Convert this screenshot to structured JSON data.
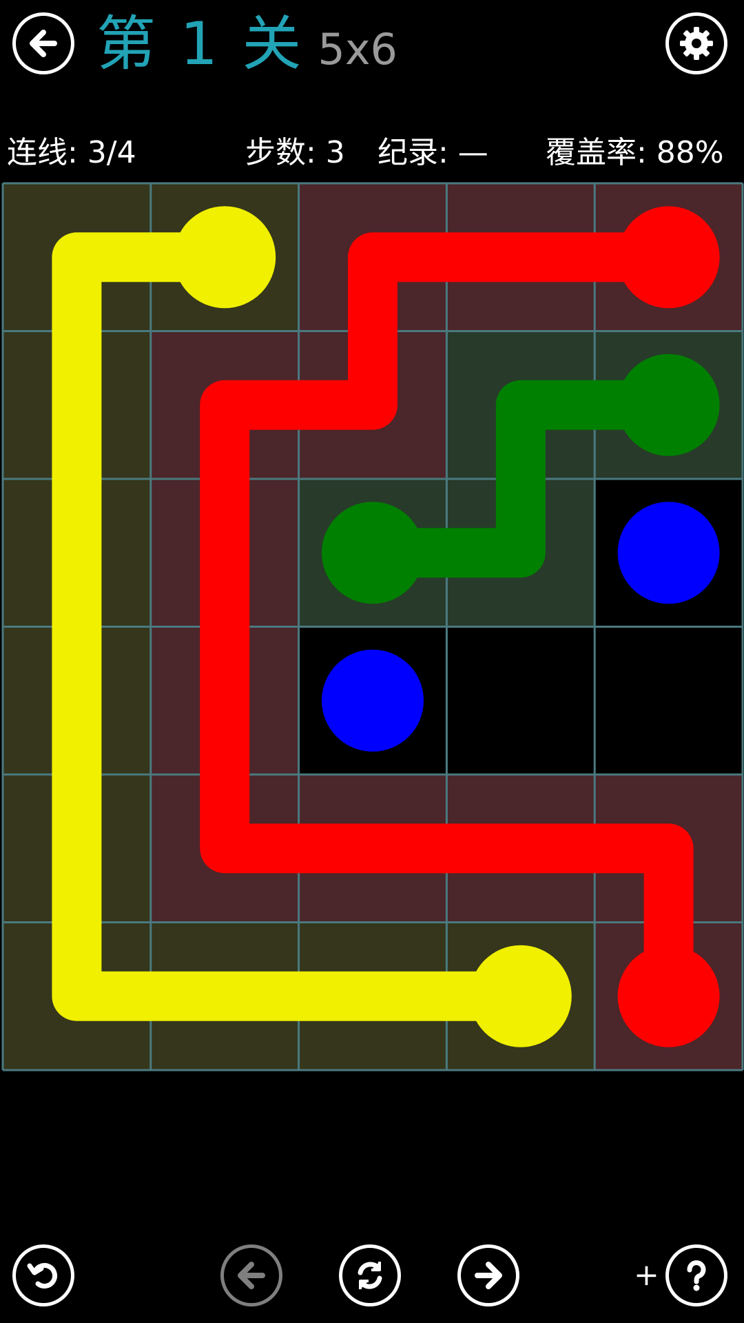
{
  "header": {
    "title": "第 1 关",
    "size_label": "5x6"
  },
  "stats": {
    "connections": "连线: 3/4",
    "moves": "步数: 3",
    "record": "纪录: —",
    "coverage": "覆盖率: 88%"
  },
  "board": {
    "cols": 5,
    "rows": 6,
    "colors": {
      "yellow": "#f0f000",
      "red": "#ff0000",
      "green": "#008000",
      "blue": "#0000ff",
      "grid_line": "#4a7a80"
    },
    "cells": [
      [
        "yellow",
        "yellow",
        "red",
        "red",
        "red"
      ],
      [
        "yellow",
        "red",
        "red",
        "green",
        "green"
      ],
      [
        "yellow",
        "red",
        "green",
        "green",
        "empty"
      ],
      [
        "yellow",
        "red",
        "empty",
        "empty",
        "empty"
      ],
      [
        "yellow",
        "red",
        "red",
        "red",
        "red"
      ],
      [
        "yellow",
        "yellow",
        "yellow",
        "yellow",
        "red"
      ]
    ],
    "endpoints": [
      {
        "color": "yellow",
        "cell": [
          0,
          1
        ]
      },
      {
        "color": "yellow",
        "cell": [
          5,
          3
        ]
      },
      {
        "color": "red",
        "cell": [
          0,
          4
        ]
      },
      {
        "color": "red",
        "cell": [
          5,
          4
        ]
      },
      {
        "color": "green",
        "cell": [
          1,
          4
        ]
      },
      {
        "color": "green",
        "cell": [
          2,
          2
        ]
      },
      {
        "color": "blue",
        "cell": [
          2,
          4
        ]
      },
      {
        "color": "blue",
        "cell": [
          3,
          2
        ]
      }
    ],
    "paths": [
      {
        "color": "yellow",
        "cells": [
          [
            0,
            1
          ],
          [
            0,
            0
          ],
          [
            1,
            0
          ],
          [
            2,
            0
          ],
          [
            3,
            0
          ],
          [
            4,
            0
          ],
          [
            5,
            0
          ],
          [
            5,
            1
          ],
          [
            5,
            2
          ],
          [
            5,
            3
          ]
        ]
      },
      {
        "color": "red",
        "cells": [
          [
            0,
            4
          ],
          [
            0,
            3
          ],
          [
            0,
            2
          ],
          [
            1,
            2
          ],
          [
            1,
            1
          ],
          [
            2,
            1
          ],
          [
            3,
            1
          ],
          [
            4,
            1
          ],
          [
            4,
            2
          ],
          [
            4,
            3
          ],
          [
            4,
            4
          ],
          [
            5,
            4
          ]
        ]
      },
      {
        "color": "green",
        "cells": [
          [
            1,
            4
          ],
          [
            1,
            3
          ],
          [
            2,
            3
          ],
          [
            2,
            2
          ]
        ]
      }
    ]
  },
  "toolbar": {
    "back_icon": "arrow-left-icon",
    "settings_icon": "gear-icon",
    "undo_icon": "undo-icon",
    "prev_icon": "arrow-left-icon",
    "restart_icon": "refresh-icon",
    "next_icon": "arrow-right-icon",
    "hint_plus": "+",
    "hint_icon": "question-icon"
  }
}
